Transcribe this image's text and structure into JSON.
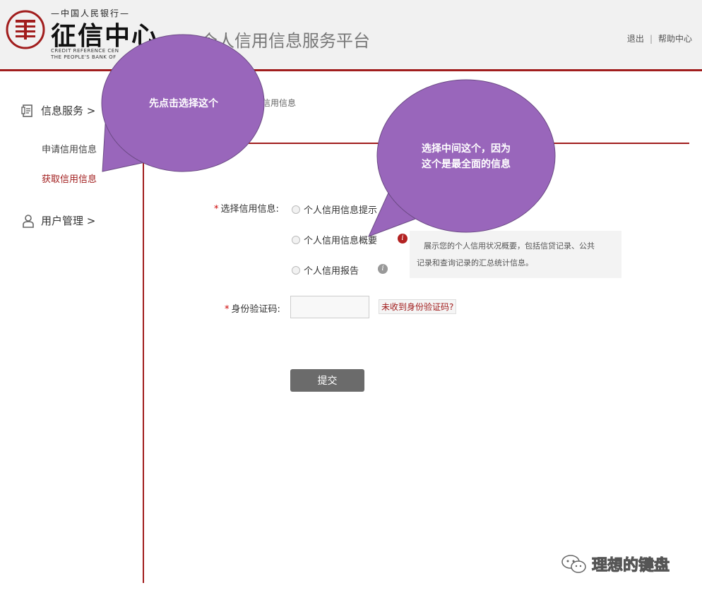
{
  "header": {
    "org_top": "—中国人民银行—",
    "org_name": "征信中心",
    "org_en_1": "CREDIT REFERENCE CEN",
    "org_en_2": "THE PEOPLE'S BANK OF",
    "platform_title": "个人信用信息服务平台",
    "logout": "退出",
    "separator": "|",
    "help": "帮助中心"
  },
  "sidebar": {
    "info_service": "信息服务 >",
    "apply_info": "申请信用信息",
    "get_info": "获取信用信息",
    "user_manage": "用户管理 >"
  },
  "breadcrumb": "信用信息",
  "form": {
    "select_label": "选择信用信息:",
    "required_mark": "*",
    "option_1": "个人信用信息提示",
    "option_2": "个人信用信息概要",
    "option_3": "个人信用报告",
    "tip_line_1": "展示您的个人信用状况概要，包括信贷记录、公共",
    "tip_line_2": "记录和查询记录的汇总统计信息。",
    "code_label": "身份验证码:",
    "no_code": "未收到身份验证码?",
    "submit": "提交"
  },
  "annotations": {
    "bubble_1": "先点击选择这个",
    "bubble_2_line1": "选择中间这个，因为",
    "bubble_2_line2": "这个是最全面的信息"
  },
  "watermark": "理想的键盘",
  "colors": {
    "accent": "#a11d1d",
    "bubble": "#9966bb"
  }
}
